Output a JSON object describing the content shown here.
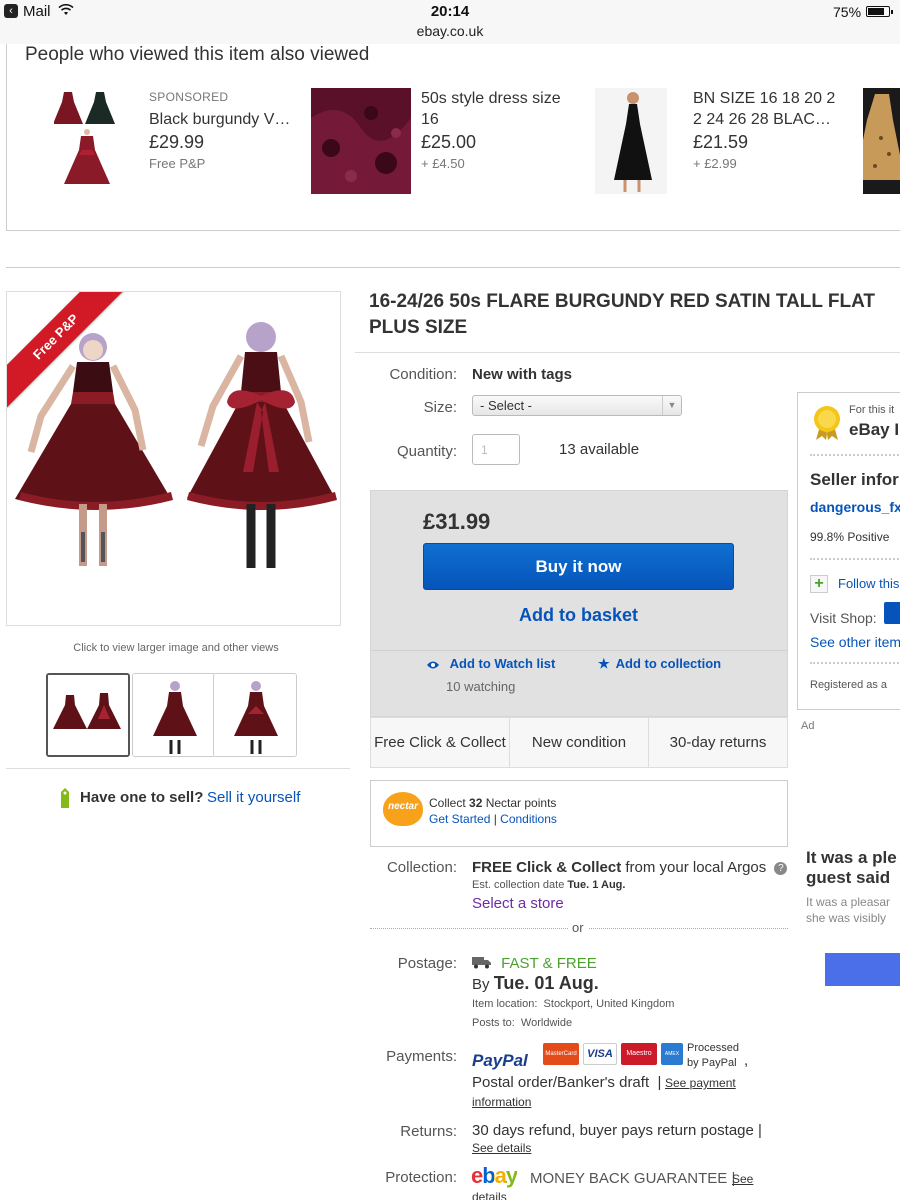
{
  "status": {
    "back_app": "Mail",
    "time": "20:14",
    "url": "ebay.co.uk",
    "battery": "75%"
  },
  "also_viewed": {
    "title": "People who viewed this item also viewed",
    "items": [
      {
        "sponsored": "SPONSORED",
        "name": "Black burgundy V…",
        "price": "£29.99",
        "postage": "Free P&P"
      },
      {
        "name": "50s style dress size 16",
        "price": "£25.00",
        "postage": "+ £4.50"
      },
      {
        "name": "BN SIZE 16 18 20 2 2 24 26 28 BLAC…",
        "price": "£21.59",
        "postage": "+ £2.99"
      }
    ]
  },
  "gallery": {
    "ribbon": "Free P&P",
    "hint": "Click to view larger image and other views",
    "sell_question": "Have one to sell?",
    "sell_link": "Sell it yourself"
  },
  "product": {
    "title_line1": "16-24/26 50s FLARE BURGUNDY RED SATIN TALL FLAT",
    "title_line2": "PLUS SIZE",
    "condition_label": "Condition:",
    "condition": "New with tags",
    "size_label": "Size:",
    "size_select": "- Select -",
    "quantity_label": "Quantity:",
    "quantity_value": "1",
    "available": "13 available"
  },
  "buy": {
    "price": "£31.99",
    "buy_now": "Buy it now",
    "add_basket": "Add to basket",
    "watch": "Add to Watch list",
    "watching": "10 watching",
    "collection": "Add to collection",
    "features": [
      "Free Click & Collect",
      "New condition",
      "30-day returns"
    ]
  },
  "nectar": {
    "logo": "nectar",
    "collect_pre": "Collect ",
    "points": "32",
    "collect_post": " Nectar points",
    "get_started": "Get Started",
    "sep": " | ",
    "conditions": "Conditions"
  },
  "collection": {
    "label": "Collection:",
    "bold": "FREE Click & Collect",
    "rest": " from your local Argos",
    "est_label": "Est. collection date ",
    "est_date": "Tue. 1 Aug.",
    "select_store": "Select a store",
    "or": "or"
  },
  "postage": {
    "label": "Postage:",
    "fast": "FAST & FREE",
    "by": "By ",
    "date": "Tue. 01 Aug.",
    "location_label": "Item location:",
    "location": "Stockport, United Kingdom",
    "posts_label": "Posts to:",
    "posts": "Worldwide"
  },
  "payments": {
    "label": "Payments:",
    "paypal": "PayPal",
    "processed": "Processed",
    "by_paypal": "by PayPal",
    "comma": ",",
    "postal": "Postal order/Banker's draft",
    "sep": "|",
    "see1": "See payment",
    "see2": "information",
    "cards": [
      "MasterCard",
      "VISA",
      "Maestro",
      "AMEX"
    ]
  },
  "returns": {
    "label": "Returns:",
    "text": "30 days refund, buyer pays return postage",
    "sep": "|",
    "details": "See details"
  },
  "protection": {
    "label": "Protection:",
    "logo": "ebay",
    "mbg": "MONEY BACK GUARANTEE",
    "sep": "|",
    "see": "See",
    "details": "details"
  },
  "seller": {
    "for_this": "For this it",
    "ebay": "eBay I",
    "info": "Seller infor",
    "name": "dangerous_fx",
    "positive": "99.8% Positive",
    "follow": "Follow this",
    "visit": "Visit Shop:",
    "see_other": "See other item",
    "registered": "Registered as a"
  },
  "ad": {
    "label": "Ad",
    "heading1": "It was a ple",
    "heading2": "guest said",
    "p1": "It was a pleasar",
    "p2": "she was visibly"
  },
  "colors": {
    "link": "#0654ba",
    "buy_button": "#0654ba",
    "ribbon": "#d11a26",
    "fast_free": "#4aa12c",
    "select_store": "#6e2aa8",
    "nectar": "#f7a21a"
  }
}
